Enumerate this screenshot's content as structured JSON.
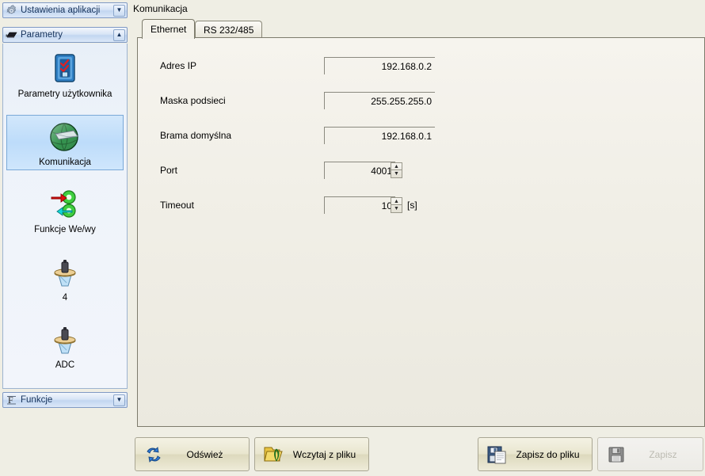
{
  "sidebar": {
    "app_bar": {
      "label": "Ustawienia aplikacji",
      "icon": "gear-icon",
      "chevron": "▼"
    },
    "group_bar": {
      "label": "Parametry",
      "icon": "chip-icon",
      "chevron": "▲"
    },
    "func_bar": {
      "label": "Funkcje",
      "icon": "function-icon",
      "chevron": "▼"
    },
    "items": [
      {
        "label": "Parametry użytkownika",
        "icon": "clipboard-checklist-icon",
        "selected": false
      },
      {
        "label": "Komunikacja",
        "icon": "globe-network-icon",
        "selected": true
      },
      {
        "label": "Funkcje We/wy",
        "icon": "io-arrows-icon",
        "selected": false
      },
      {
        "label": "4",
        "icon": "scale-icon",
        "selected": false
      },
      {
        "label": "ADC",
        "icon": "scale-icon",
        "selected": false
      }
    ]
  },
  "main": {
    "breadcrumb": "Komunikacja",
    "tabs": [
      {
        "label": "Ethernet",
        "active": true
      },
      {
        "label": "RS 232/485",
        "active": false
      }
    ],
    "fields": [
      {
        "label": "Adres IP",
        "value": "192.168.0.2",
        "spinner": false,
        "unit": ""
      },
      {
        "label": "Maska podsieci",
        "value": "255.255.255.0",
        "spinner": false,
        "unit": ""
      },
      {
        "label": "Brama domyślna",
        "value": "192.168.0.1",
        "spinner": false,
        "unit": ""
      },
      {
        "label": "Port",
        "value": "4001",
        "spinner": true,
        "unit": ""
      },
      {
        "label": "Timeout",
        "value": "10",
        "spinner": true,
        "unit": "[s]"
      }
    ]
  },
  "toolbar": {
    "refresh": {
      "label": "Odśwież",
      "icon": "refresh-arrows-icon",
      "enabled": true
    },
    "load": {
      "label": "Wczytaj z pliku",
      "icon": "open-folder-icon",
      "enabled": true
    },
    "save_as": {
      "label": "Zapisz do pliku",
      "icon": "save-as-icon",
      "enabled": true
    },
    "save": {
      "label": "Zapisz",
      "icon": "floppy-icon",
      "enabled": false
    }
  },
  "colors": {
    "window_bg": "#efeee4",
    "panel_bg": "#f2f0e8",
    "accent_blue": "#bddcfa",
    "button_khaki": "#e9e6cf",
    "border": "#7d7b6c"
  }
}
